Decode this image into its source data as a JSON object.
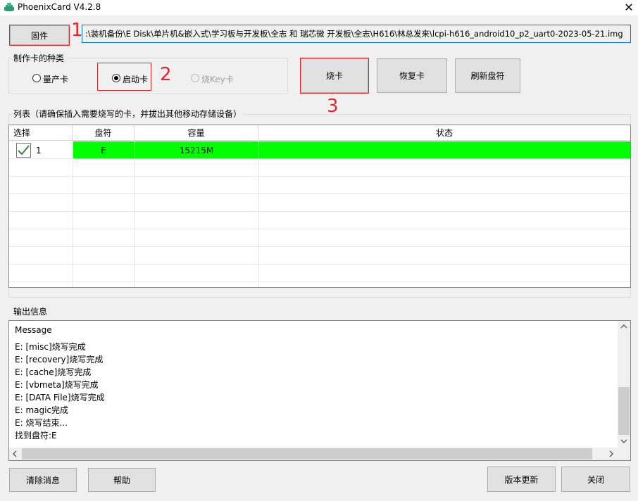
{
  "window": {
    "title": "PhoenixCard V4.2.8",
    "close": "✕"
  },
  "firmware": {
    "button": "固件",
    "path": ":\\装机备份\\E Disk\\单片机&嵌入式\\学习板与开发板\\全志 和 瑞芯微 开发板\\全志\\H616\\林总发来\\lcpi-h616_android10_p2_uart0-2023-05-21.img"
  },
  "card_type": {
    "title": "制作卡的种类",
    "options": [
      {
        "label": "量产卡",
        "selected": false,
        "enabled": true
      },
      {
        "label": "启动卡",
        "selected": true,
        "enabled": true
      },
      {
        "label": "烧Key卡",
        "selected": false,
        "enabled": false
      }
    ]
  },
  "actions": {
    "burn": "烧卡",
    "restore": "恢复卡",
    "refresh": "刷新盘符"
  },
  "annotations": [
    "1",
    "2",
    "3"
  ],
  "list": {
    "title": "列表（请确保插入需要烧写的卡，并拔出其他移动存储设备）",
    "columns": [
      "选择",
      "盘符",
      "容量",
      "状态"
    ],
    "rows": [
      {
        "index": "1",
        "checked": true,
        "drive": "E",
        "capacity": "15215M",
        "status": "",
        "status_color": "#00ff00"
      }
    ]
  },
  "output": {
    "title": "输出信息",
    "lines": [
      "Message",
      "E: [misc]烧写完成",
      "E: [recovery]烧写完成",
      "E: [cache]烧写完成",
      "E: [vbmeta]烧写完成",
      "E: [DATA File]烧写完成",
      "E: magic完成",
      "E: 烧写结束...",
      "找到盘符:E"
    ]
  },
  "footer": {
    "clear": "清除消息",
    "help": "帮助",
    "update": "版本更新",
    "close": "关闭"
  },
  "colors": {
    "annotation": "#e8262a",
    "status_ok": "#00ff00",
    "path_border": "#0078d7"
  }
}
